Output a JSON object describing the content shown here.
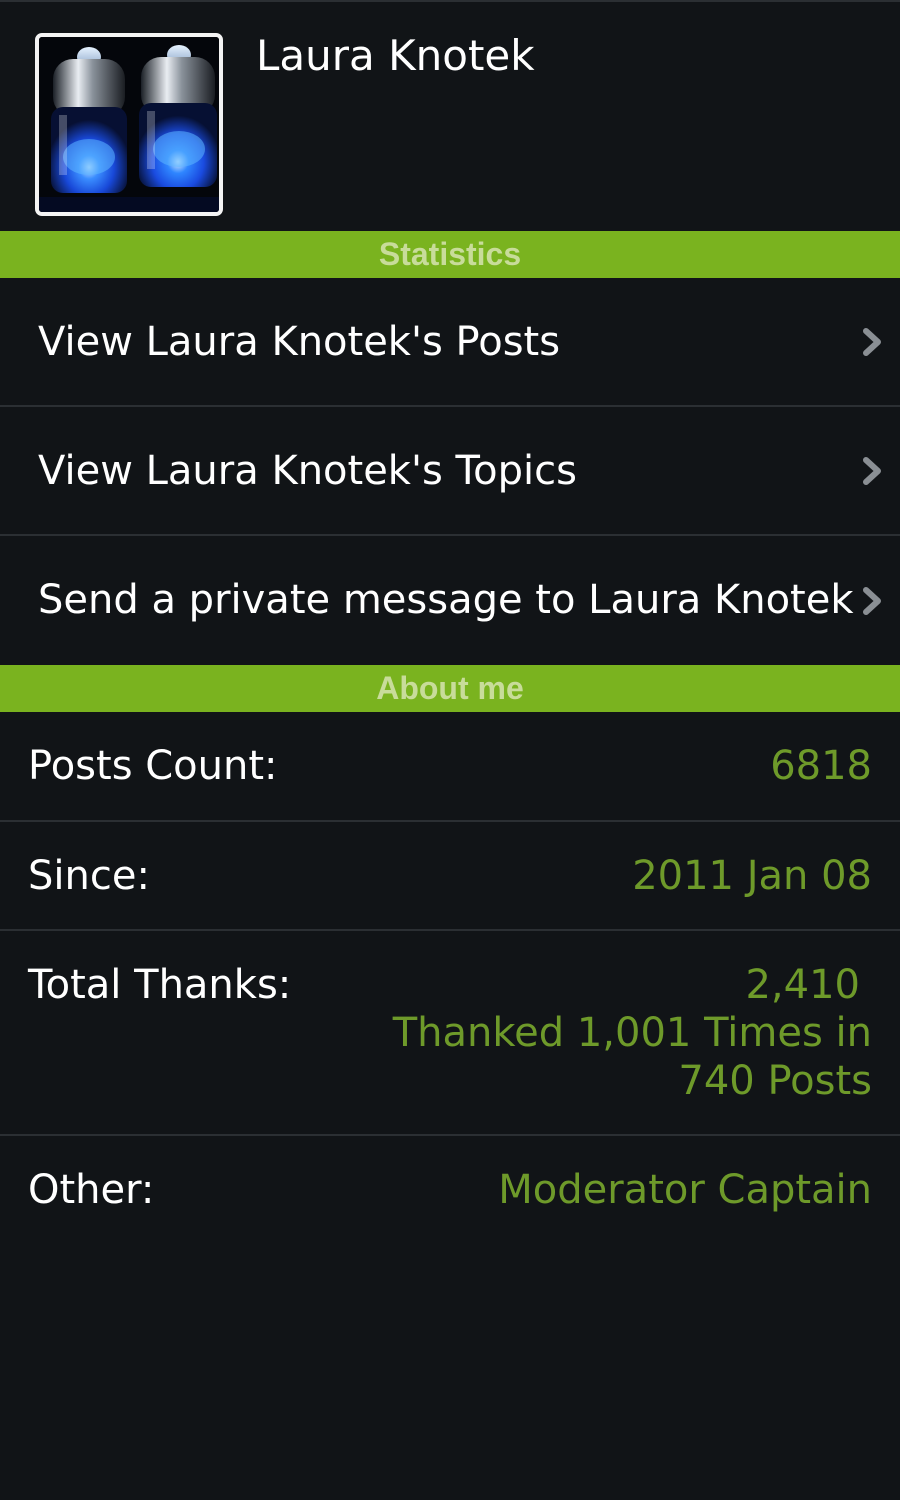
{
  "profile": {
    "username": "Laura Knotek",
    "avatar_icon": "glowing-vacuum-tubes-image"
  },
  "statistics": {
    "header": "Statistics",
    "links": [
      {
        "label": "View Laura Knotek's Posts",
        "icon": "chevron-right-icon"
      },
      {
        "label": "View Laura Knotek's Topics",
        "icon": "chevron-right-icon"
      },
      {
        "label": "Send a private message to Laura Knotek",
        "icon": "chevron-right-icon"
      }
    ]
  },
  "about": {
    "header": "About me",
    "posts_count": {
      "label": "Posts Count:",
      "value": "6818"
    },
    "since": {
      "label": "Since:",
      "value": "2011 Jan 08"
    },
    "total_thanks": {
      "label": "Total Thanks:",
      "count": "2,410",
      "line1": "Thanked 1,001 Times in",
      "line2": "740 Posts"
    },
    "other": {
      "label": "Other:",
      "value": "Moderator Captain"
    }
  },
  "colors": {
    "background": "#111417",
    "accent_green": "#7ab31f",
    "header_text": "#c8dc9a",
    "value_green": "#6e9a2a",
    "divider": "#2b2f33"
  }
}
